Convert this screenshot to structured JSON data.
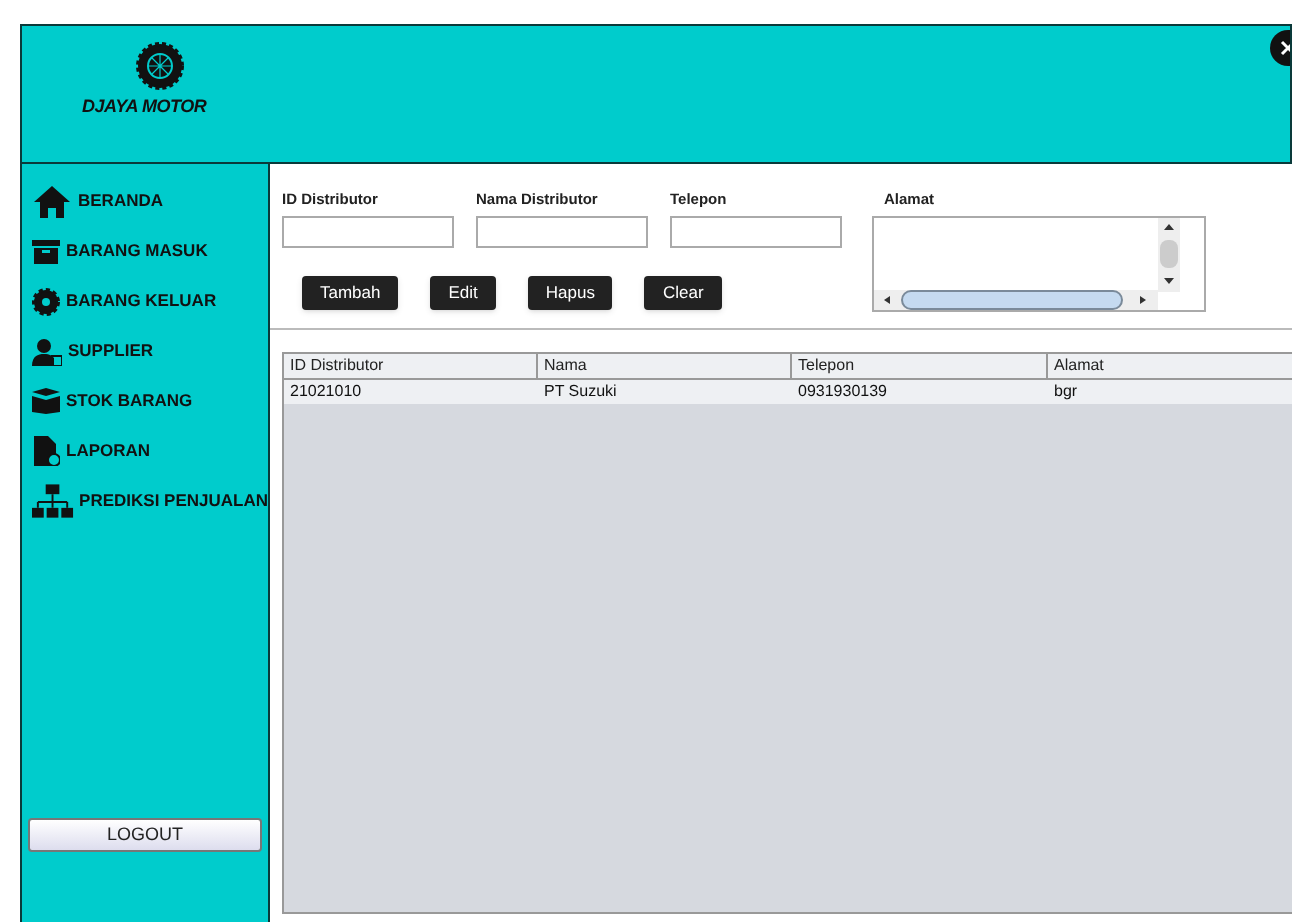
{
  "logo": {
    "text": "DJAYA MOTOR"
  },
  "sidebar": {
    "items": [
      {
        "label": "BERANDA"
      },
      {
        "label": "BARANG MASUK"
      },
      {
        "label": "BARANG KELUAR"
      },
      {
        "label": "SUPPLIER"
      },
      {
        "label": "STOK BARANG"
      },
      {
        "label": "LAPORAN"
      },
      {
        "label": "PREDIKSI PENJUALAN"
      }
    ],
    "logout": "LOGOUT"
  },
  "form": {
    "fields": [
      {
        "label": "ID Distributor",
        "kind": "input"
      },
      {
        "label": "Nama Distributor",
        "kind": "input"
      },
      {
        "label": "Telepon",
        "kind": "input"
      },
      {
        "label": "Alamat",
        "kind": "textarea"
      }
    ],
    "buttons": [
      "Tambah",
      "Edit",
      "Hapus",
      "Clear"
    ]
  },
  "table": {
    "columns": [
      "ID Distributor",
      "Nama",
      "Telepon",
      "Alamat"
    ],
    "rows": [
      [
        "21021010",
        "PT Suzuki",
        "0931930139",
        "bgr"
      ]
    ]
  }
}
